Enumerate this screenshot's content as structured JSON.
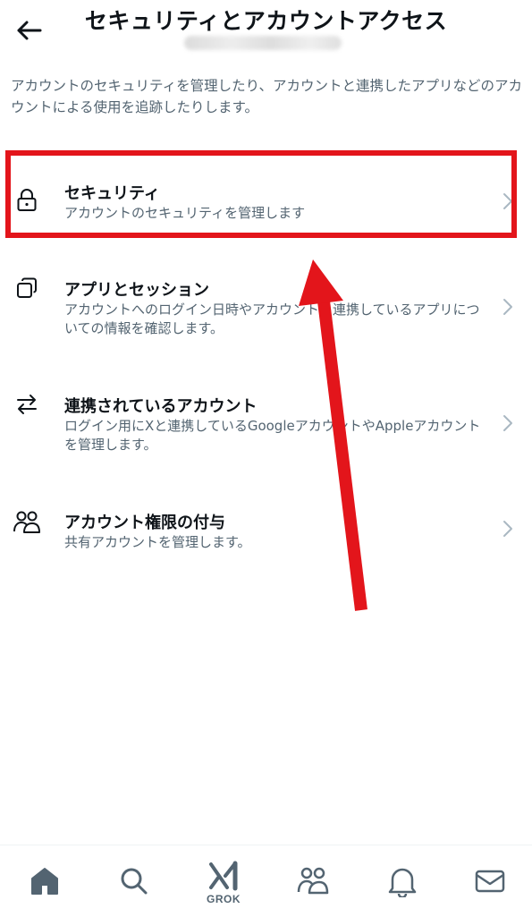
{
  "header": {
    "title": "セキュリティとアカウントアクセス",
    "back_icon": "back-arrow-icon"
  },
  "description": "アカウントのセキュリティを管理したり、アカウントと連携したアプリなどのアカウントによる使用を追跡したりします。",
  "menu": {
    "items": [
      {
        "title": "セキュリティ",
        "subtitle": "アカウントのセキュリティを管理します",
        "icon": "lock-icon"
      },
      {
        "title": "アプリとセッション",
        "subtitle": "アカウントへのログイン日時やアカウントと連携しているアプリについての情報を確認します。",
        "icon": "apps-sessions-icon"
      },
      {
        "title": "連携されているアカウント",
        "subtitle": "ログイン用にXと連携しているGoogleアカウントやAppleアカウントを管理します。",
        "icon": "swap-arrows-icon"
      },
      {
        "title": "アカウント権限の付与",
        "subtitle": "共有アカウントを管理します。",
        "icon": "people-icon"
      }
    ]
  },
  "bottom_nav": {
    "items": [
      {
        "icon": "home-icon"
      },
      {
        "icon": "search-icon"
      },
      {
        "icon": "grok-icon",
        "label": "GROK"
      },
      {
        "icon": "communities-icon"
      },
      {
        "icon": "notifications-bell-icon"
      },
      {
        "icon": "messages-envelope-icon"
      }
    ]
  },
  "colors": {
    "text_primary": "#0f1419",
    "text_secondary": "#536471",
    "annotation_red": "#e3151b",
    "icon_gray": "#536471"
  }
}
